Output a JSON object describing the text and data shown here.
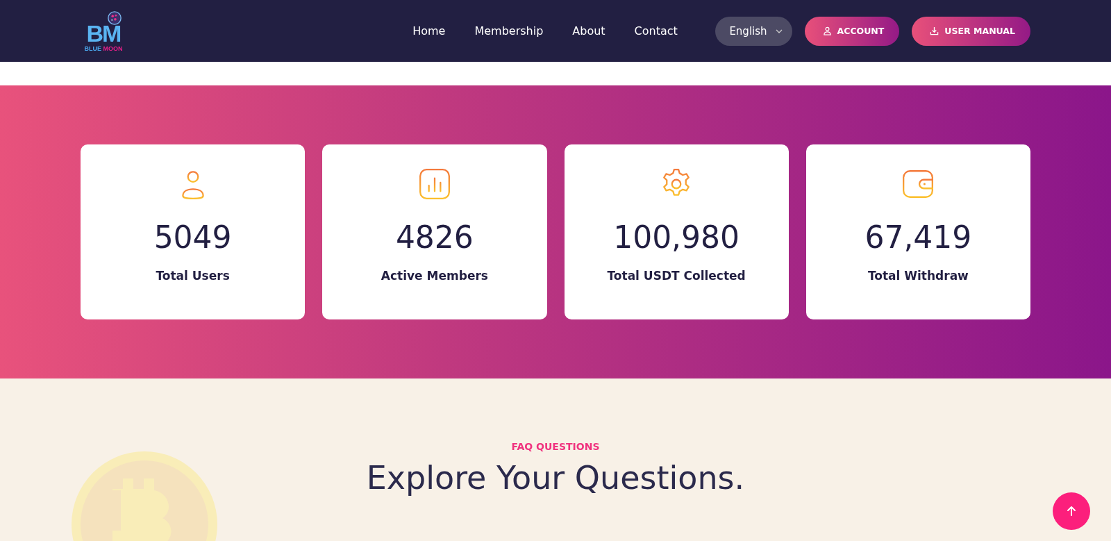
{
  "header": {
    "logo": {
      "letters": "BM",
      "name_first": "BLUE",
      "name_second": "MOON"
    },
    "nav": [
      {
        "label": "Home"
      },
      {
        "label": "Membership"
      },
      {
        "label": "About"
      },
      {
        "label": "Contact"
      }
    ],
    "language": "English",
    "buttons": [
      {
        "kind": "account",
        "label": "ACCOUNT"
      },
      {
        "kind": "download",
        "label": "USER MANUAL"
      }
    ]
  },
  "stats": [
    {
      "kind": "user",
      "value": "5049",
      "label": "Total Users"
    },
    {
      "kind": "chart",
      "value": "4826",
      "label": "Active Members"
    },
    {
      "kind": "gear",
      "value": "100,980",
      "label": "Total USDT Collected"
    },
    {
      "kind": "wallet",
      "value": "67,419",
      "label": "Total Withdraw"
    }
  ],
  "faq": {
    "eyebrow": "FAQ QUESTIONS",
    "title": "Explore Your Questions."
  }
}
